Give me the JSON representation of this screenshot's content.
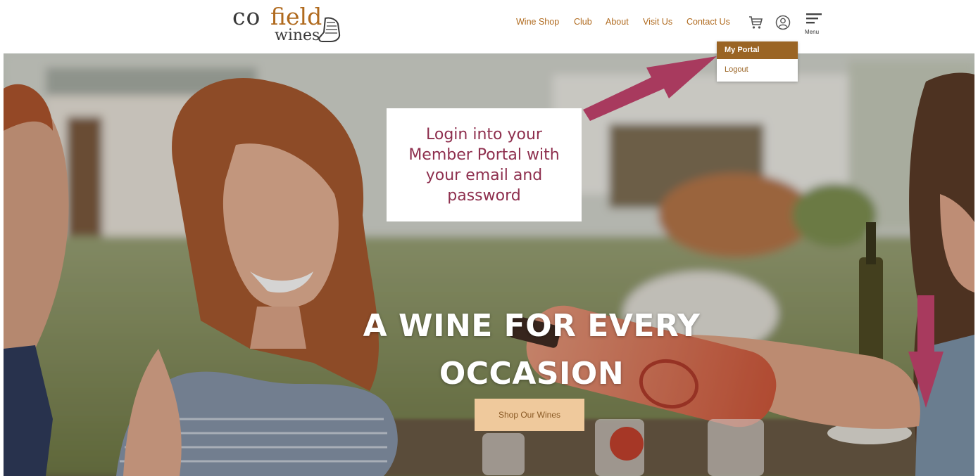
{
  "brand": {
    "logo_co": "co",
    "logo_field": "field",
    "logo_wines": "wines"
  },
  "nav": {
    "links": [
      "Wine Shop",
      "Club",
      "About",
      "Visit Us",
      "Contact Us"
    ],
    "menu_label": "Menu"
  },
  "dropdown": {
    "items": [
      "My Portal",
      "Logout"
    ]
  },
  "callout": {
    "text": "Login into your Member Portal with your email and password"
  },
  "hero": {
    "heading_line1": "A WINE FOR EVERY",
    "heading_line2": "OCCASION",
    "button_label": "Shop Our Wines"
  },
  "colors": {
    "brand_orange": "#b06a1e",
    "dropdown_active": "#9a6424",
    "callout_text": "#8e2f4e",
    "annotation_arrow": "#a83a5e",
    "button_bg": "#efc99c"
  },
  "icons": [
    "boot-icon",
    "cart-icon",
    "user-account-icon",
    "hamburger-menu-icon"
  ]
}
